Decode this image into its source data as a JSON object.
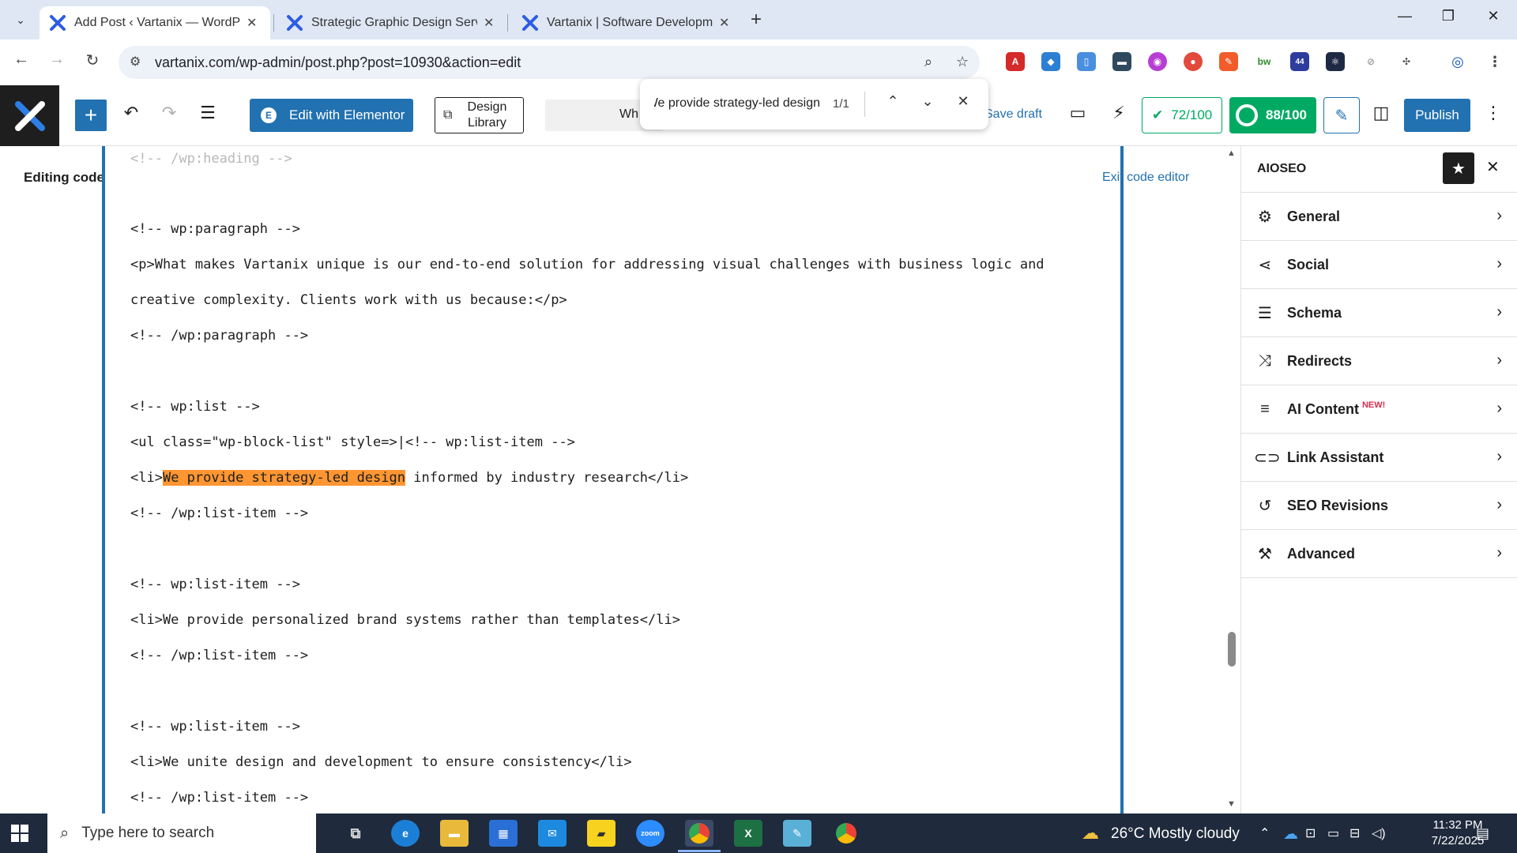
{
  "browser": {
    "tabs": [
      {
        "title": "Add Post ‹ Vartanix — WordPre",
        "active": true
      },
      {
        "title": "Strategic Graphic Design Servic",
        "active": false
      },
      {
        "title": "Vartanix | Software Developmen",
        "active": false
      }
    ],
    "url": "vartanix.com/wp-admin/post.php?post=10930&action=edit",
    "extension_badge": "44"
  },
  "find_bar": {
    "query": "We provide strategy-led design",
    "count": "1/1"
  },
  "editor_header": {
    "elementor_label": "Edit with Elementor",
    "design_library_label": "Design Library",
    "document_title_fragment": "Wh",
    "save_draft_label": "Save draft",
    "score_readability": "72/100",
    "score_seo": "88/100",
    "publish_label": "Publish"
  },
  "left_panel": {
    "editing_label": "Editing code",
    "exit_label": "Exit code editor"
  },
  "code_lines": [
    {
      "text": "<!-- /wp:heading -->",
      "faded": true
    },
    {
      "text": "<!-- wp:paragraph -->"
    },
    {
      "text": "<p>What makes Vartanix unique is our end-to-end solution for addressing visual challenges with business logic and"
    },
    {
      "text": "creative complexity. Clients work with us because:</p>"
    },
    {
      "text": "<!-- /wp:paragraph -->"
    },
    {
      "text": "<!-- wp:list -->"
    },
    {
      "text": "<ul class=\"wp-block-list\" style=>|<!-- wp:list-item -->"
    },
    {
      "pre": "<li>",
      "highlight": "We provide strategy-led design",
      "post": " informed by industry research</li>"
    },
    {
      "text": "<!-- /wp:list-item -->"
    },
    {
      "text": "<!-- wp:list-item -->"
    },
    {
      "text": "<li>We provide personalized brand systems rather than templates</li>"
    },
    {
      "text": "<!-- /wp:list-item -->"
    },
    {
      "text": "<!-- wp:list-item -->"
    },
    {
      "text": "<li>We unite design and development to ensure consistency</li>"
    },
    {
      "text": "<!-- /wp:list-item -->"
    }
  ],
  "sidebar": {
    "title": "AIOSEO",
    "items": [
      {
        "label": "General",
        "icon": "gear-icon"
      },
      {
        "label": "Social",
        "icon": "share-icon"
      },
      {
        "label": "Schema",
        "icon": "schema-icon"
      },
      {
        "label": "Redirects",
        "icon": "redirect-icon"
      },
      {
        "label": "AI Content",
        "icon": "ai-content-icon",
        "badge": "NEW!"
      },
      {
        "label": "Link Assistant",
        "icon": "link-icon"
      },
      {
        "label": "SEO Revisions",
        "icon": "history-icon"
      },
      {
        "label": "Advanced",
        "icon": "wrench-icon"
      }
    ]
  },
  "taskbar": {
    "search_placeholder": "Type here to search",
    "weather": "26°C  Mostly cloudy",
    "time": "11:32 PM",
    "date": "7/22/2025"
  },
  "colors": {
    "wp_blue": "#2271b1",
    "find_highlight": "#ff9632",
    "aioseo_green": "#00aa63",
    "taskbar_bg": "#1f2a3c"
  }
}
